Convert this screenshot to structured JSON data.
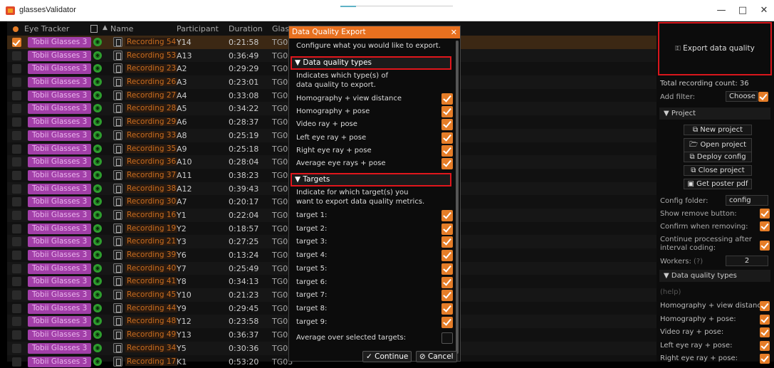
{
  "window": {
    "title": "glassesValidator",
    "minimize": "—",
    "maximize": "□",
    "close": "✕"
  },
  "table": {
    "headers": {
      "eye_tracker": "Eye Tracker",
      "name": "Name",
      "participant": "Participant",
      "duration": "Duration",
      "glasses": "Glas"
    },
    "rows": [
      {
        "tracker": "Tobii Glasses 3",
        "name": "Recording 54",
        "participant": "Y14",
        "duration": "0:21:58",
        "col": "TG03",
        "selected": true
      },
      {
        "tracker": "Tobii Glasses 3",
        "name": "Recording 53",
        "participant": "A13",
        "duration": "0:36:49",
        "col": "TG03",
        "selected": false
      },
      {
        "tracker": "Tobii Glasses 3",
        "name": "Recording 23",
        "participant": "A2",
        "duration": "0:29:29",
        "col": "TG03",
        "selected": false
      },
      {
        "tracker": "Tobii Glasses 3",
        "name": "Recording 26",
        "participant": "A3",
        "duration": "0:23:01",
        "col": "TG03",
        "selected": false
      },
      {
        "tracker": "Tobii Glasses 3",
        "name": "Recording 27",
        "participant": "A4",
        "duration": "0:33:08",
        "col": "TG03",
        "selected": false
      },
      {
        "tracker": "Tobii Glasses 3",
        "name": "Recording 28",
        "participant": "A5",
        "duration": "0:34:22",
        "col": "TG03",
        "selected": false
      },
      {
        "tracker": "Tobii Glasses 3",
        "name": "Recording 29",
        "participant": "A6",
        "duration": "0:28:37",
        "col": "TG03",
        "selected": false
      },
      {
        "tracker": "Tobii Glasses 3",
        "name": "Recording 33",
        "participant": "A8",
        "duration": "0:25:19",
        "col": "TG03",
        "selected": false
      },
      {
        "tracker": "Tobii Glasses 3",
        "name": "Recording 35",
        "participant": "A9",
        "duration": "0:25:18",
        "col": "TG03",
        "selected": false
      },
      {
        "tracker": "Tobii Glasses 3",
        "name": "Recording 36",
        "participant": "A10",
        "duration": "0:28:04",
        "col": "TG03",
        "selected": false
      },
      {
        "tracker": "Tobii Glasses 3",
        "name": "Recording 37",
        "participant": "A11",
        "duration": "0:38:23",
        "col": "TG03",
        "selected": false
      },
      {
        "tracker": "Tobii Glasses 3",
        "name": "Recording 38",
        "participant": "A12",
        "duration": "0:39:43",
        "col": "TG03",
        "selected": false
      },
      {
        "tracker": "Tobii Glasses 3",
        "name": "Recording 30",
        "participant": "A7",
        "duration": "0:20:17",
        "col": "TG03",
        "selected": false
      },
      {
        "tracker": "Tobii Glasses 3",
        "name": "Recording 16",
        "participant": "Y1",
        "duration": "0:22:04",
        "col": "TG03",
        "selected": false
      },
      {
        "tracker": "Tobii Glasses 3",
        "name": "Recording 19",
        "participant": "Y2",
        "duration": "0:18:57",
        "col": "TG03",
        "selected": false
      },
      {
        "tracker": "Tobii Glasses 3",
        "name": "Recording 21",
        "participant": "Y3",
        "duration": "0:27:25",
        "col": "TG03",
        "selected": false
      },
      {
        "tracker": "Tobii Glasses 3",
        "name": "Recording 39",
        "participant": "Y6",
        "duration": "0:13:24",
        "col": "TG03",
        "selected": false
      },
      {
        "tracker": "Tobii Glasses 3",
        "name": "Recording 40",
        "participant": "Y7",
        "duration": "0:25:49",
        "col": "TG03",
        "selected": false
      },
      {
        "tracker": "Tobii Glasses 3",
        "name": "Recording 41",
        "participant": "Y8",
        "duration": "0:34:13",
        "col": "TG03",
        "selected": false
      },
      {
        "tracker": "Tobii Glasses 3",
        "name": "Recording 45",
        "participant": "Y10",
        "duration": "0:21:23",
        "col": "TG03",
        "selected": false
      },
      {
        "tracker": "Tobii Glasses 3",
        "name": "Recording 44",
        "participant": "Y9",
        "duration": "0:29:45",
        "col": "TG03",
        "selected": false
      },
      {
        "tracker": "Tobii Glasses 3",
        "name": "Recording 48",
        "participant": "Y12",
        "duration": "0:23:58",
        "col": "TG03",
        "selected": false
      },
      {
        "tracker": "Tobii Glasses 3",
        "name": "Recording 49",
        "participant": "Y13",
        "duration": "0:36:37",
        "col": "TG03",
        "selected": false
      },
      {
        "tracker": "Tobii Glasses 3",
        "name": "Recording 34",
        "participant": "Y5",
        "duration": "0:30:36",
        "col": "TG03",
        "selected": false
      },
      {
        "tracker": "Tobii Glasses 3",
        "name": "Recording 17",
        "participant": "K1",
        "duration": "0:53:20",
        "col": "TG03",
        "selected": false
      }
    ]
  },
  "dialog": {
    "title": "Data Quality Export",
    "close": "✕",
    "intro": "Configure what you would like to export.",
    "dq_section": "▼  Data quality types",
    "dq_help_1": "Indicates which type(s) of",
    "dq_help_2": "data quality to export.",
    "dq_options": [
      "Homography + view distance",
      "Homography + pose",
      "Video ray + pose",
      "Left eye ray + pose",
      "Right eye ray + pose",
      "Average eye rays + pose"
    ],
    "targets_section": "▼  Targets",
    "targets_help_1": "Indicate for which target(s) you",
    "targets_help_2": "want to export data quality metrics.",
    "targets": [
      "target 1:",
      "target 2:",
      "target 3:",
      "target 4:",
      "target 5:",
      "target 6:",
      "target 7:",
      "target 8:",
      "target 9:"
    ],
    "average": "Average over selected targets:",
    "continue": "✓ Continue",
    "cancel": "⊘ Cancel"
  },
  "side": {
    "export": "🗉 Export data quality",
    "count": "Total recording count: 36",
    "filter_label": "Add filter:",
    "filter_value": "Choose",
    "project_section": "▼  Project",
    "new_project": "⧉ New project",
    "open_project": "🗁 Open project",
    "deploy_config": "⧉ Deploy config",
    "close_project": "⧉ Close project",
    "poster": "▣ Get poster pdf",
    "config_folder_label": "Config folder:",
    "config_folder_value": "config",
    "show_remove": "Show remove button:",
    "confirm_remove": "Confirm when removing:",
    "continue_processing_1": "Continue processing after",
    "continue_processing_2": "interval coding:",
    "workers_label": "Workers:",
    "workers_help": "(?)",
    "workers_value": "2",
    "dq_section": "▼  Data quality types",
    "help": "(help)",
    "dq_items": [
      "Homography + view distanc",
      "Homography + pose:",
      "Video ray + pose:",
      "Left eye ray + pose:",
      "Right eye ray + pose:"
    ]
  }
}
